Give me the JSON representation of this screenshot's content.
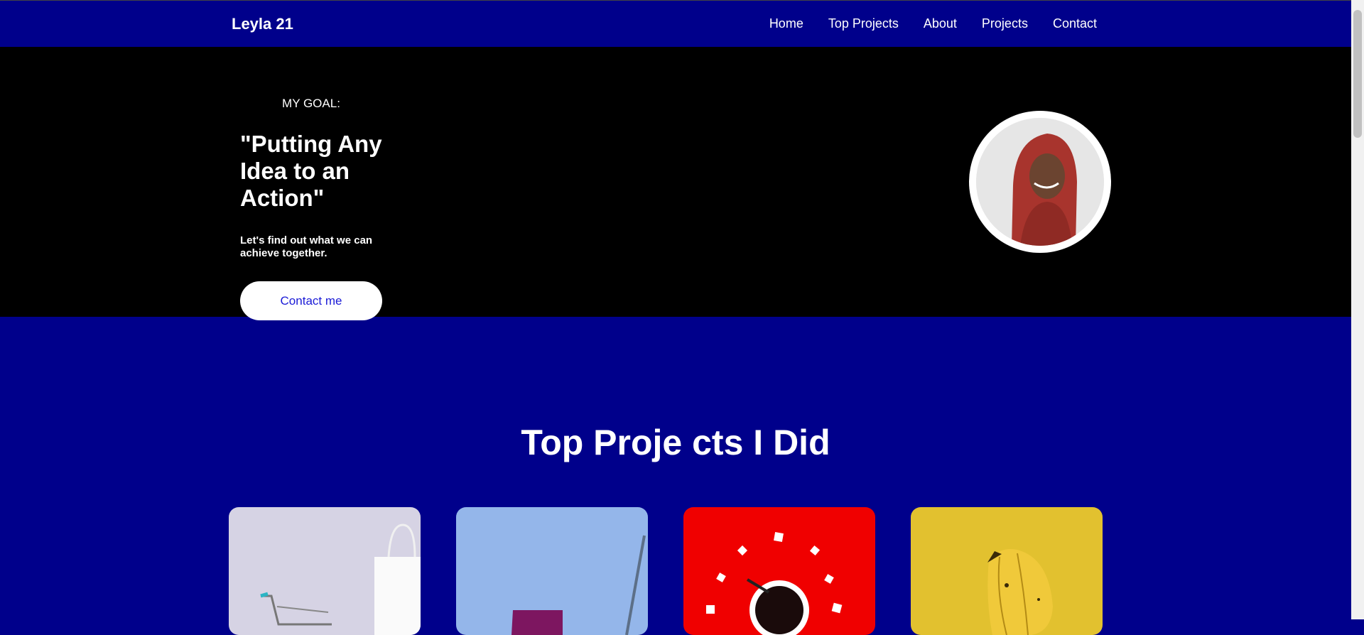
{
  "nav": {
    "brand": "Leyla 21",
    "links": [
      "Home",
      "Top Projects",
      "About",
      "Projects",
      "Contact"
    ]
  },
  "hero": {
    "goal_label": "MY GOAL:",
    "quote": "\"Putting Any Idea to an Action\"",
    "subtitle": "Let's find out what we can achieve together.",
    "cta": "Contact me"
  },
  "section": {
    "title": "Top Proje cts I Did"
  },
  "cards": [
    {
      "image": "shopping-cart-image"
    },
    {
      "image": "laptop-sky-image"
    },
    {
      "image": "coffee-cup-red-image"
    },
    {
      "image": "bananas-yellow-image"
    }
  ],
  "colors": {
    "brand_blue": "#00008b",
    "hero_bg": "#000000",
    "button_text": "#1a1ad6"
  }
}
